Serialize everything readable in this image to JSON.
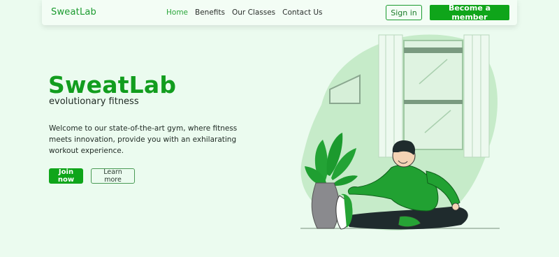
{
  "nav": {
    "brand": "SweatLab",
    "links": [
      "Home",
      "Benefits",
      "Our Classes",
      "Contact Us"
    ],
    "active_link": "Home",
    "sign_in": "Sign in",
    "cta": "Become a member"
  },
  "hero": {
    "title": "SweatLab",
    "tagline": "evolutionary fitness",
    "description": "Welcome to our state-of-the-art gym, where fitness meets innovation, provide you with an exhilarating workout experience.",
    "primary_button": "Join now",
    "secondary_button": "Learn more"
  },
  "colors": {
    "brand_green": "#129d1e",
    "button_green": "#0fa51a",
    "background": "#ebfbef",
    "illustration_blob": "#c6ebc9"
  },
  "illustration": {
    "icon": "man-stretching-illustration"
  }
}
